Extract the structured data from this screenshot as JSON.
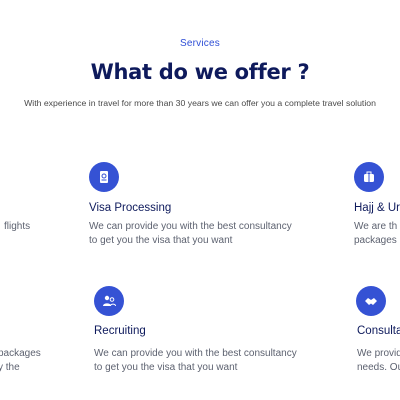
{
  "header": {
    "eyebrow": "Services",
    "title": "What do we offer ?",
    "subtitle": "With experience in travel for more than 30 years we can offer you a complete travel solution"
  },
  "services": {
    "flights": {
      "desc_line1": "flights"
    },
    "visa": {
      "title": "Visa Processing",
      "desc_line1": "We can provide you with the best consultancy",
      "desc_line2": "to get you the visa that you want",
      "icon": "passport-icon"
    },
    "hajj": {
      "title": "Hajj & Ur",
      "desc_line1": "We are  th",
      "desc_line2": "packages",
      "icon": "luggage-icon"
    },
    "packages": {
      "desc_line1": "packages",
      "desc_line2": "y the"
    },
    "recruiting": {
      "title": "Recruiting",
      "desc_line1": "We can provide you with the best consultancy",
      "desc_line2": "to get you the visa that you want",
      "icon": "people-icon"
    },
    "consulting": {
      "title": "Consulta",
      "desc_line1": "We provid",
      "desc_line2": "needs. Ou",
      "icon": "handshake-icon"
    }
  },
  "colors": {
    "accent": "#3552d4",
    "heading": "#0e1a5c",
    "body": "#5d6270"
  }
}
